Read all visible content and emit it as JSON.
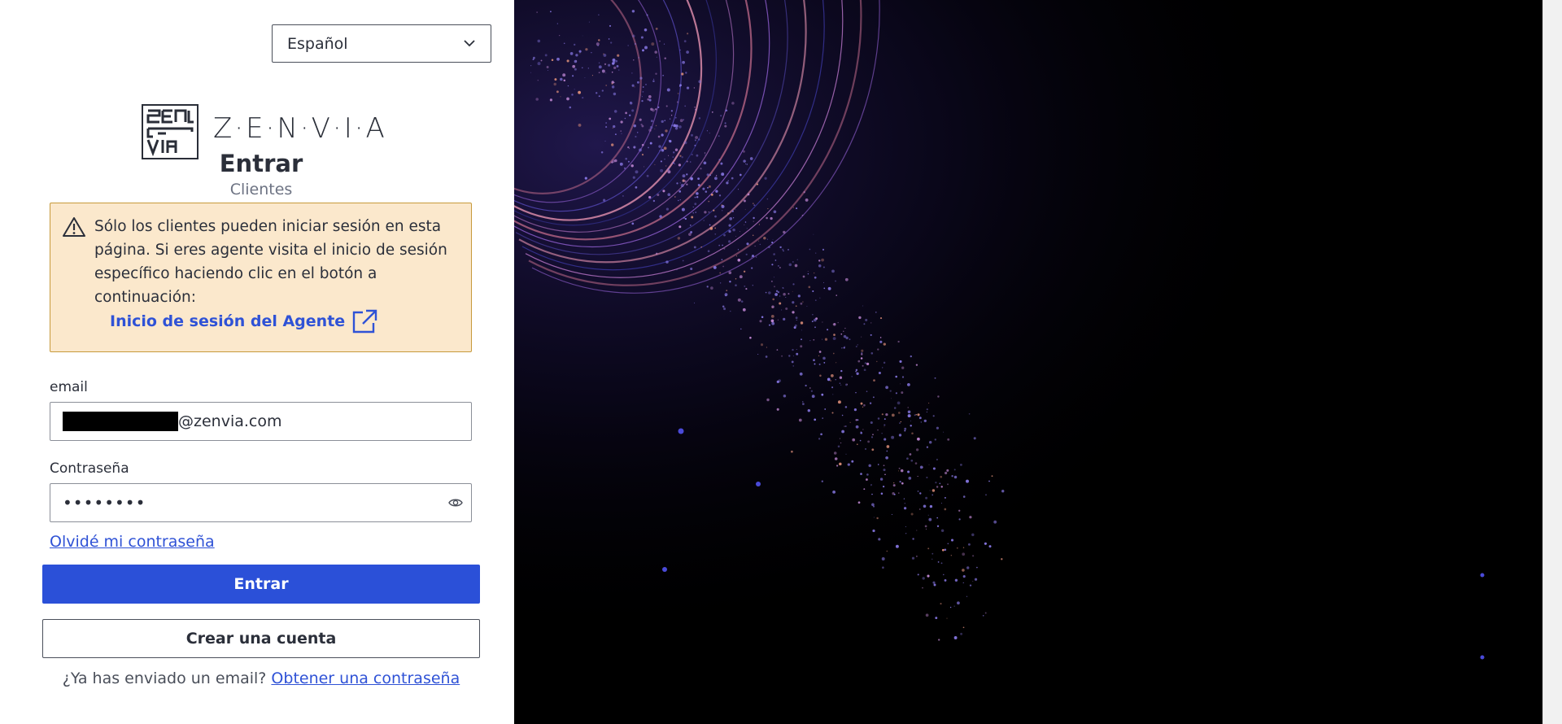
{
  "language_select": {
    "value": "Español"
  },
  "brand": {
    "wordmark": "Z·E·N·V·I·A",
    "mark_text": "ZEN VIA"
  },
  "header": {
    "title": "Entrar",
    "subtitle": "Clientes"
  },
  "alert": {
    "message": "Sólo los clientes pueden iniciar sesión en esta página. Si eres agente visita el inicio de sesión específico haciendo clic en el botón a continuación:",
    "link_label": "Inicio de sesión del Agente",
    "icon": "warning-icon",
    "link_icon": "external-link-icon"
  },
  "form": {
    "email": {
      "label": "email",
      "value_suffix": "@zenvia.com"
    },
    "password": {
      "label": "Contraseña",
      "masked_value": "••••••••",
      "toggle_icon": "eye-icon"
    },
    "forgot_label": "Olvidé mi contraseña",
    "submit_label": "Entrar",
    "create_label": "Crear una cuenta"
  },
  "footer": {
    "question": "¿Ya has enviado un email?",
    "link_label": "Obtener una contraseña"
  },
  "colors": {
    "primary": "#2b50d8",
    "link": "#2f52d6",
    "alert_bg": "#fbe8cc",
    "alert_border": "#c79a3b",
    "hero_bg": "#000000"
  }
}
